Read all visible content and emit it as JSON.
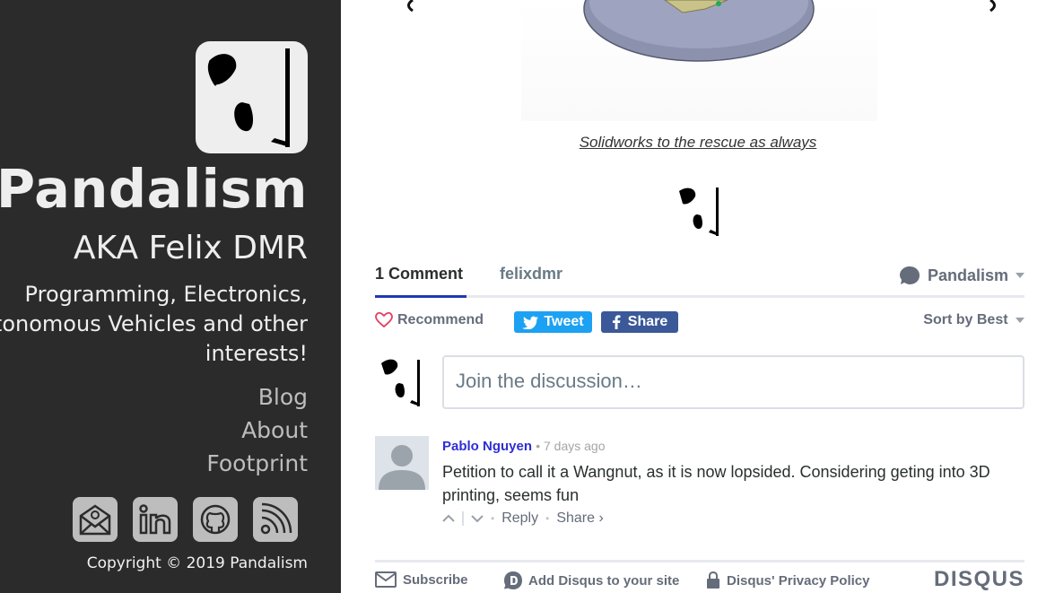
{
  "sidebar": {
    "title": "Pandalism",
    "aka": "AKA Felix DMR",
    "description": "Programming, Electronics, Autonomous Vehicles and other interests!",
    "nav": [
      "Blog",
      "About",
      "Footprint"
    ],
    "social_icons": [
      "email-icon",
      "linkedin-icon",
      "github-icon",
      "rss-icon"
    ],
    "copyright": "Copyright © 2019 Pandalism"
  },
  "post": {
    "caption": "Solidworks to the rescue as always"
  },
  "disqus": {
    "tabs": [
      "1 Comment",
      "felixdmr"
    ],
    "forum_name": "Pandalism",
    "recommend_label": "Recommend",
    "tweet_label": "Tweet",
    "share_label": "Share",
    "sort_label": "Sort by Best",
    "composer_placeholder": "Join the discussion…",
    "comment": {
      "author": "Pablo Nguyen",
      "time": "7 days ago",
      "body": "Petition to call it a Wangnut, as it is now lopsided. Considering geting into 3D printing, seems fun",
      "reply_label": "Reply",
      "share_label": "Share ›"
    },
    "footer": {
      "subscribe": "Subscribe",
      "add_disqus": "Add Disqus to your site",
      "privacy": "Disqus' Privacy Policy",
      "brand": "DISQUS"
    }
  },
  "colors": {
    "sidebar_bg": "#2b2b2b",
    "tweet_blue": "#1da1f2",
    "facebook_blue": "#3b5998",
    "author_link": "#2e2ed6"
  }
}
